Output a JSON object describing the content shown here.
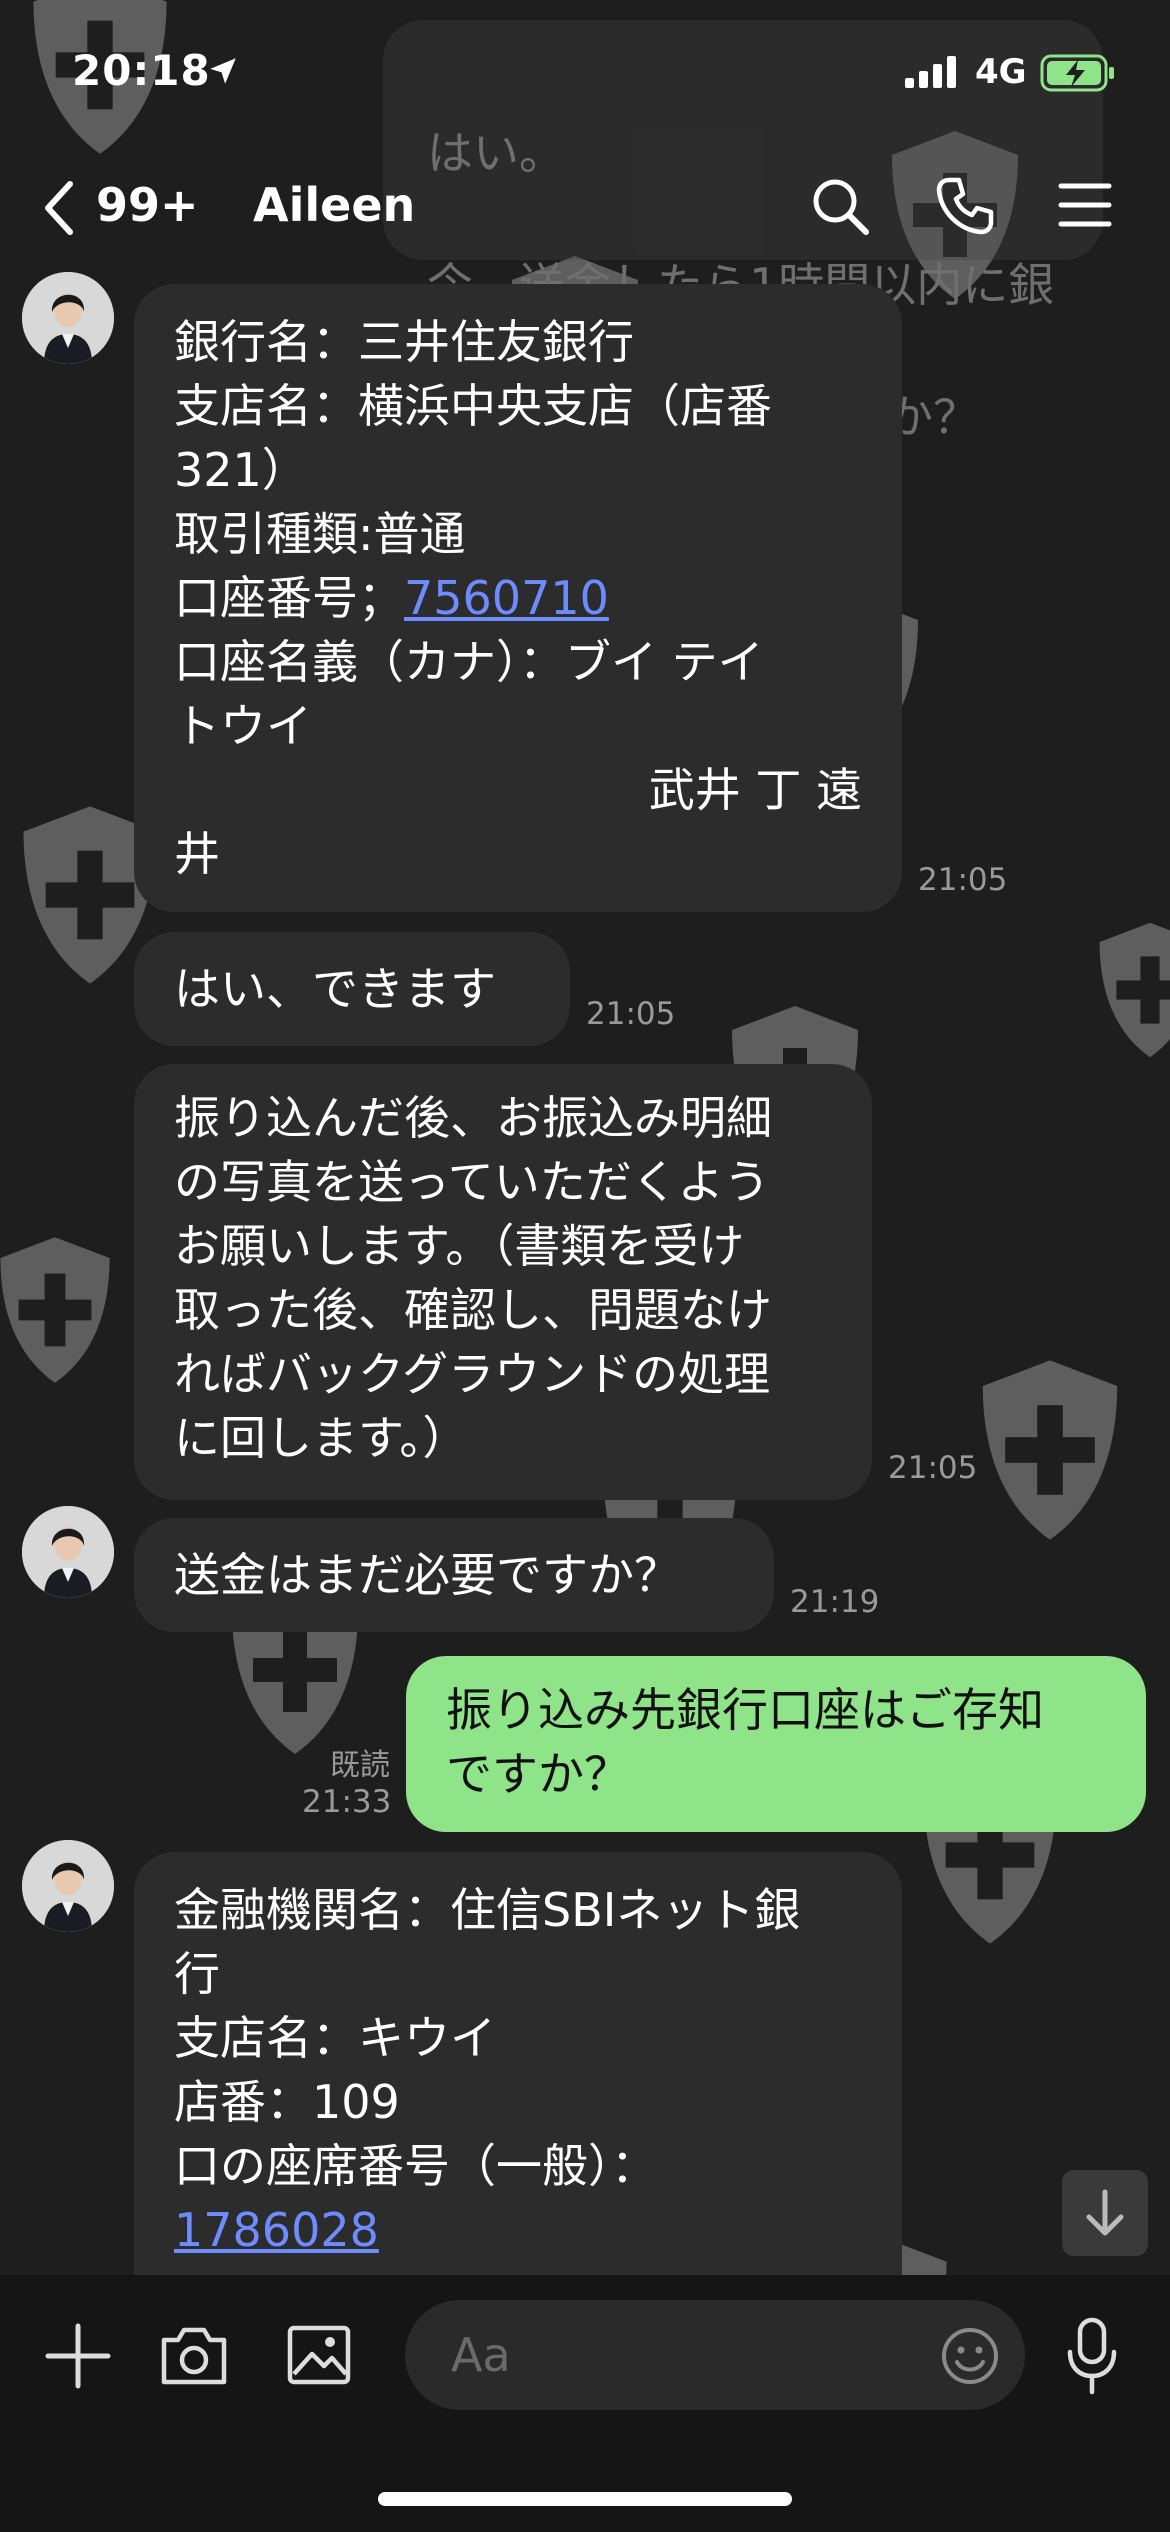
{
  "status": {
    "time": "20:18",
    "network": "4G"
  },
  "ghost_message": [
    "はい。",
    "今、送金したら1時間以内に銀",
    "行口座に入金されますか？"
  ],
  "header": {
    "unread": "99+",
    "title": "Aileen"
  },
  "messages": [
    {
      "lines": [
        "銀行名：三井住友銀行",
        "支店名：横浜中央支店（店番",
        "321）",
        "取引種類:普通",
        "口座番号；",
        "口座名義（カナ）：ブイ テイ",
        "トウイ",
        "武井 丁 遠",
        "井"
      ],
      "link": "7560710",
      "time": "21:05"
    },
    {
      "lines": [
        "はい、できます"
      ],
      "time": "21:05"
    },
    {
      "lines": [
        "振り込んだ後、お振込み明細",
        "の写真を送っていただくよう",
        "お願いします。（書類を受け",
        "取った後、確認し、問題なけ",
        "ればバックグラウンドの処理",
        "に回します。）"
      ],
      "time": "21:05"
    },
    {
      "lines": [
        "送金はまだ必要ですか？"
      ],
      "time": "21:19"
    },
    {
      "lines": [
        "振り込み先銀行口座はご存知",
        "ですか？"
      ],
      "read": "既読",
      "time": "21:33"
    },
    {
      "lines": [
        "金融機関名：住信SBIネット銀",
        "行",
        "支店名：キウイ",
        "店番：109",
        "口の座席番号（一般）："
      ],
      "link": "1786028"
    }
  ],
  "input": {
    "placeholder": "Aa"
  },
  "colors": {
    "background": "#1e1e1e",
    "bubble_in": "#2c2c2c",
    "bubble_out": "#8fe388",
    "link": "#6f8cff"
  }
}
